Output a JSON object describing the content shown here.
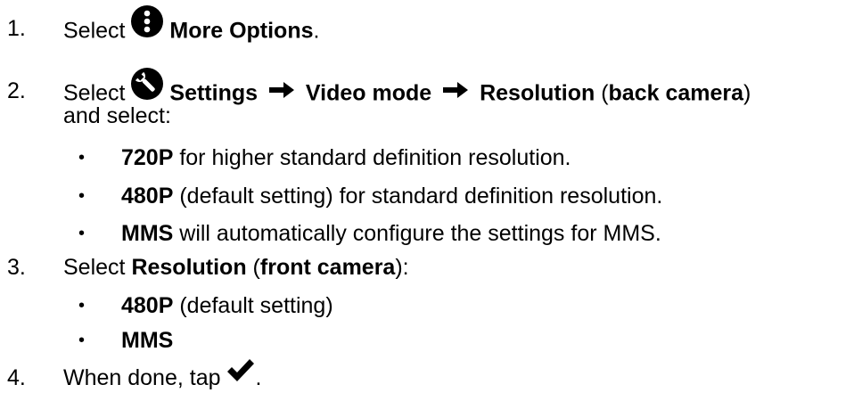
{
  "steps": [
    {
      "number": "1.",
      "select": "Select",
      "icon": "more-options-icon",
      "label": "More Options",
      "tail": "."
    },
    {
      "number": "2.",
      "select": "Select",
      "icon": "settings-wrench-icon",
      "path": [
        "Settings",
        "Video mode",
        "Resolution"
      ],
      "paren_open": " (",
      "camera": "back camera",
      "paren_close": ")",
      "continuation": "and select:",
      "bullets": [
        {
          "bold": "720P",
          "text": " for higher standard definition resolution."
        },
        {
          "bold": "480P",
          "text": " (default setting) for standard definition resolution."
        },
        {
          "bold": "MMS",
          "text": " will automatically configure the settings for MMS."
        }
      ]
    },
    {
      "number": "3.",
      "select": "Select",
      "label": "Resolution",
      "paren_open": " (",
      "camera": "front camera",
      "paren_close": ")",
      "tail": ":",
      "bullets": [
        {
          "bold": "480P",
          "text": " (default setting)"
        },
        {
          "bold": "MMS",
          "text": ""
        }
      ]
    },
    {
      "number": "4.",
      "text": "When done, tap",
      "icon": "checkmark-icon",
      "tail": "."
    }
  ],
  "bullet_char": "•",
  "colors": {
    "text": "#000000",
    "background": "#ffffff"
  }
}
